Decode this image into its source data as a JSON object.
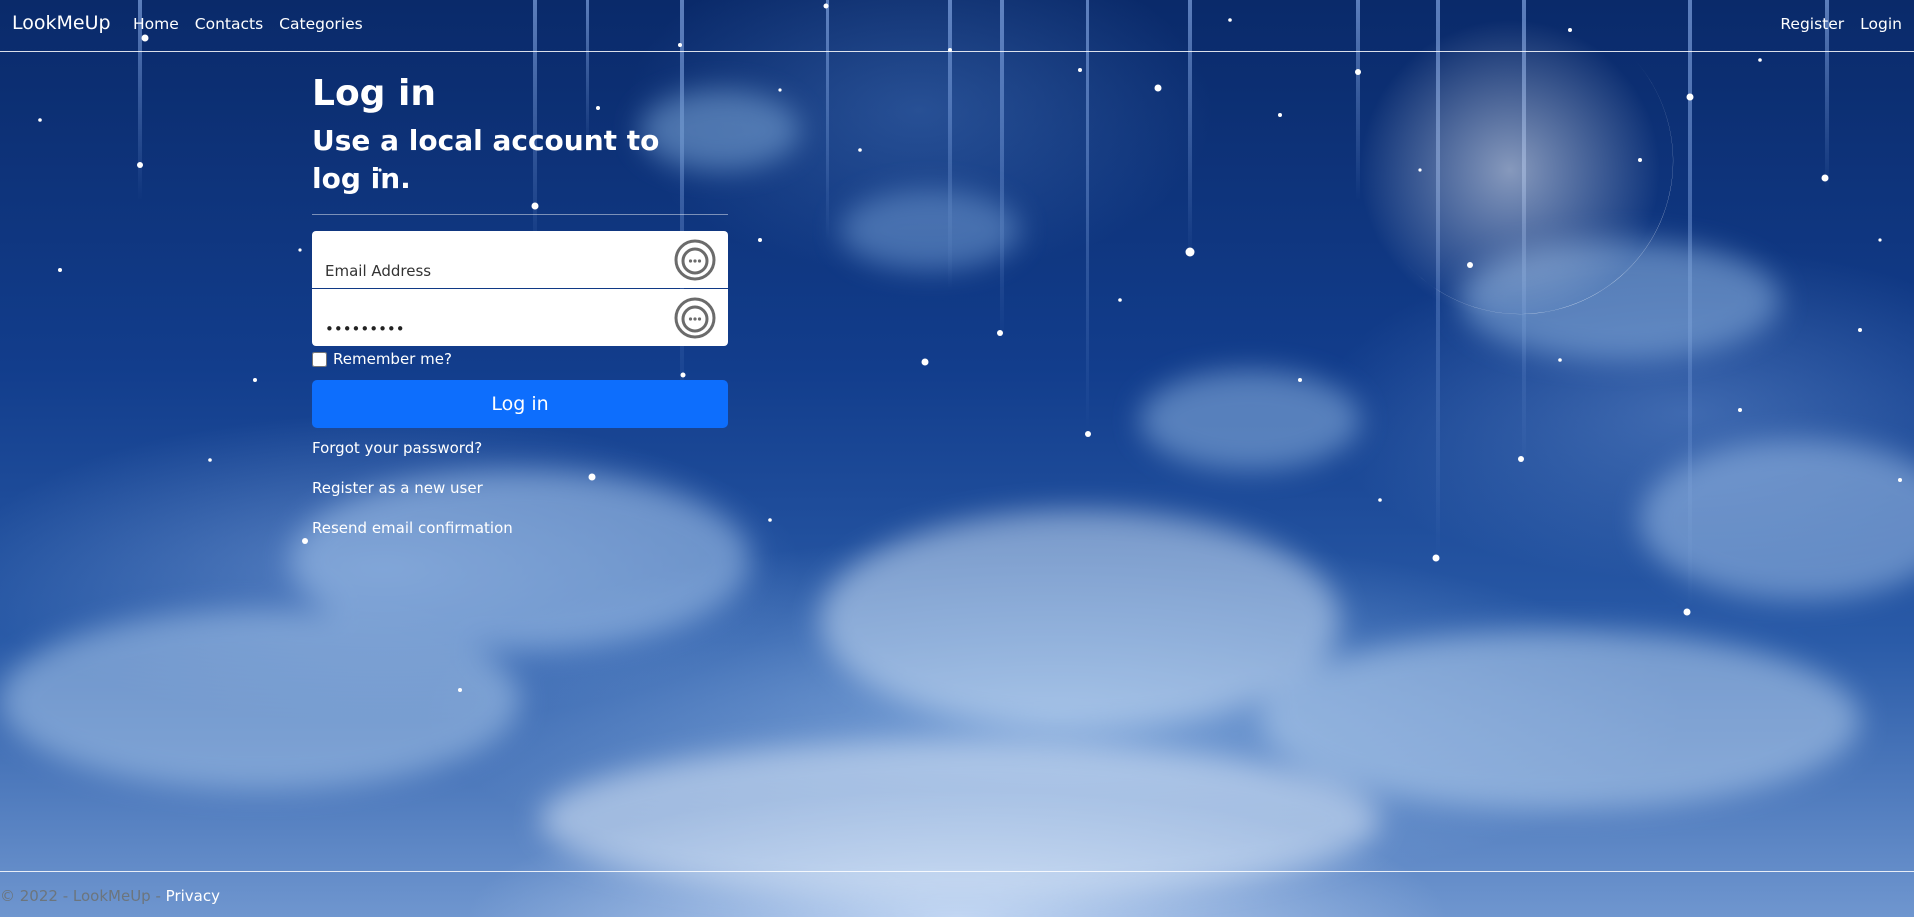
{
  "nav": {
    "brand": "LookMeUp",
    "left_links": [
      "Home",
      "Contacts",
      "Categories"
    ],
    "right_links": [
      "Register",
      "Login"
    ]
  },
  "form": {
    "title": "Log in",
    "subtitle": "Use a local account to log in.",
    "email_placeholder": "Email Address",
    "email_value": "",
    "password_value": "•••••••••",
    "remember_label": "Remember me?",
    "remember_checked": false,
    "submit_label": "Log in",
    "links": [
      "Forgot your password?",
      "Register as a new user",
      "Resend email confirmation"
    ]
  },
  "footer": {
    "copyright": "© 2022 - LookMeUp -",
    "privacy_label": "Privacy"
  },
  "theme": {
    "accent": "#0d6efd",
    "sky_dark": "#0a2a6a",
    "text": "#ffffff",
    "muted": "#6c757d"
  }
}
